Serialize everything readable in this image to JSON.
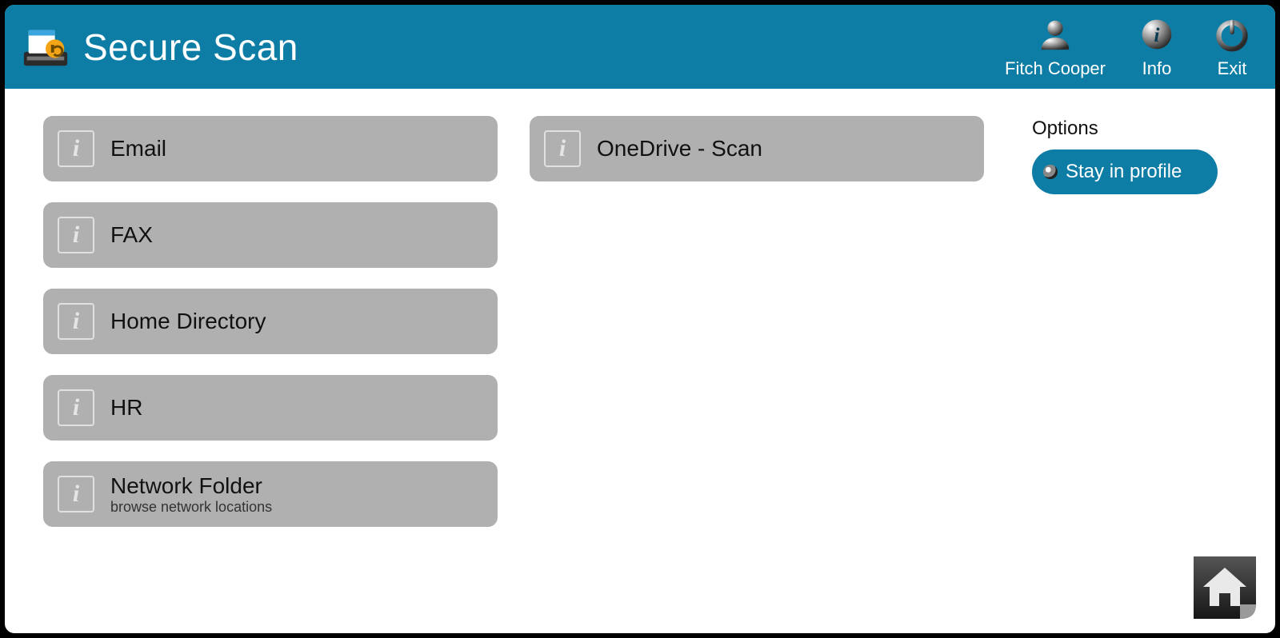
{
  "header": {
    "title": "Secure Scan",
    "user_label": "Fitch Cooper",
    "info_label": "Info",
    "exit_label": "Exit"
  },
  "tiles": {
    "col1": [
      {
        "title": "Email",
        "subtitle": ""
      },
      {
        "title": "FAX",
        "subtitle": ""
      },
      {
        "title": "Home Directory",
        "subtitle": ""
      },
      {
        "title": "HR",
        "subtitle": ""
      },
      {
        "title": "Network Folder",
        "subtitle": "browse network locations"
      }
    ],
    "col2": [
      {
        "title": "OneDrive - Scan",
        "subtitle": ""
      }
    ]
  },
  "options": {
    "heading": "Options",
    "stay_in_profile": "Stay in profile"
  }
}
